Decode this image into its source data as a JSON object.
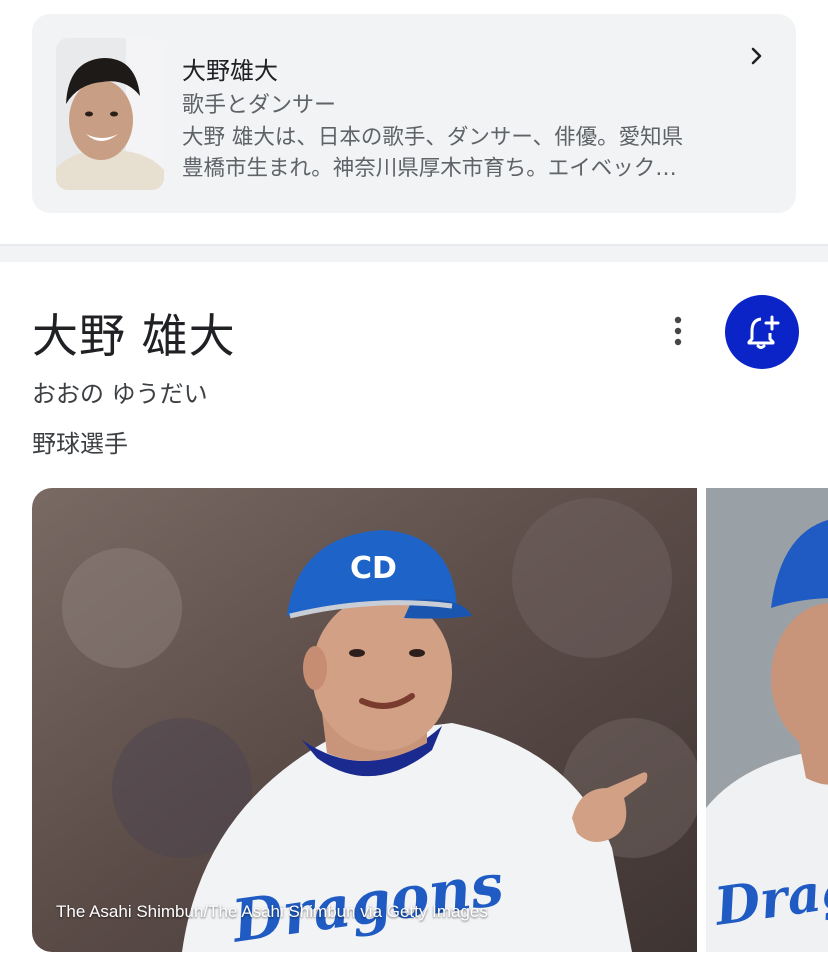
{
  "related_card": {
    "name": "大野雄大",
    "subtitle": "歌手とダンサー",
    "description_line1": "大野 雄大は、日本の歌手、ダンサー、俳優。愛知県",
    "description_line2": "豊橋市生まれ。神奈川県厚木市育ち。エイベック…"
  },
  "entity": {
    "title": "大野 雄大",
    "reading": "おおの ゆうだい",
    "occupation": "野球選手"
  },
  "images": {
    "credit": "The Asahi Shimbun/The Asahi Shimbun via Getty Images",
    "jersey_text": "Dragons"
  },
  "colors": {
    "accent": "#0b24c7",
    "card_bg": "#f1f3f4"
  },
  "icons": {
    "chevron": "chevron-right-icon",
    "more": "more-vert-icon",
    "notify": "bell-plus-icon"
  }
}
